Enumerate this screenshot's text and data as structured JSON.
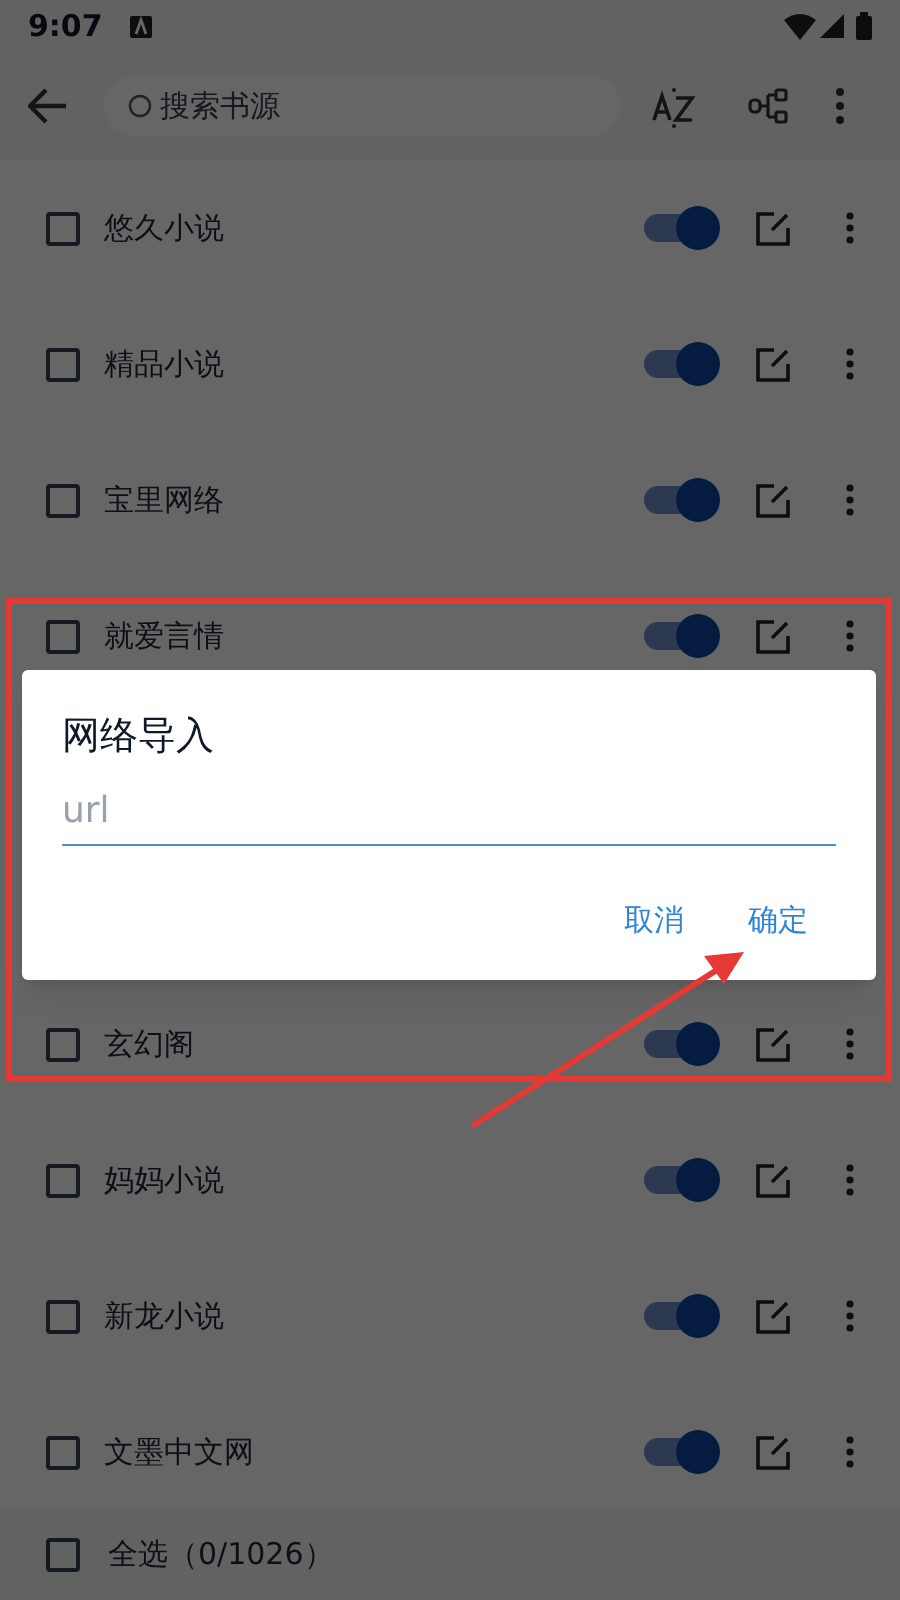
{
  "status_bar": {
    "time": "9:07"
  },
  "toolbar": {
    "search": {
      "placeholder": "搜索书源"
    }
  },
  "sources": [
    {
      "name": "悠久小说",
      "checked": false,
      "on": true
    },
    {
      "name": "精品小说",
      "checked": false,
      "on": true
    },
    {
      "name": "宝里网络",
      "checked": false,
      "on": true
    },
    {
      "name": "就爱言情",
      "checked": false,
      "on": true
    },
    {
      "name": "玄幻阁",
      "checked": false,
      "on": true
    },
    {
      "name": "妈妈小说",
      "checked": false,
      "on": true
    },
    {
      "name": "新龙小说",
      "checked": false,
      "on": true
    },
    {
      "name": "文墨中文网",
      "checked": false,
      "on": true
    }
  ],
  "select_all": {
    "label": "全选（0/1026）",
    "checked": false
  },
  "dialog": {
    "title": "网络导入",
    "input": {
      "placeholder": "url"
    },
    "buttons": [
      "取消",
      "确定"
    ]
  }
}
